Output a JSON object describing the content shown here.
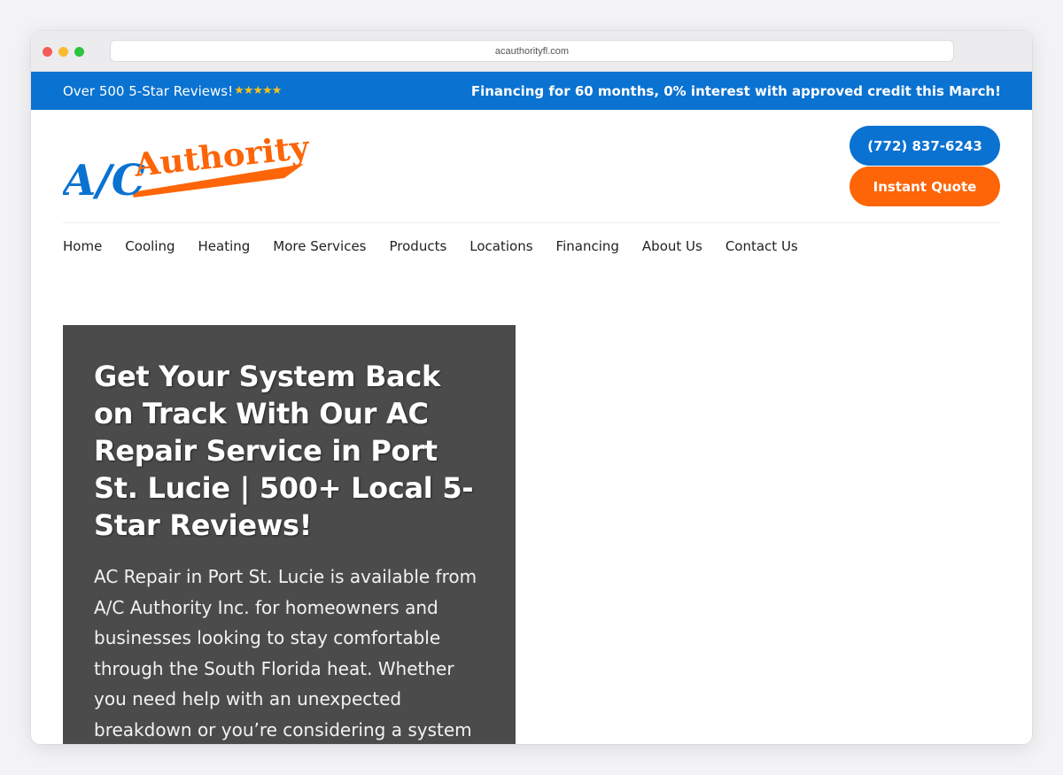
{
  "browser": {
    "url": "acauthorityfl.com"
  },
  "topbar": {
    "reviews_text": "Over 500 5-Star Reviews!",
    "stars": "★★★★★",
    "financing_text": "Financing for 60 months, 0% interest with approved credit this March!"
  },
  "logo": {
    "part1": "A/C",
    "part2": "Authority",
    "colors": {
      "blue": "#0a72d1",
      "orange": "#fd6508"
    }
  },
  "cta": {
    "phone_label": "(772) 837-6243",
    "quote_label": "Instant Quote"
  },
  "nav": {
    "items": [
      "Home",
      "Cooling",
      "Heating",
      "More Services",
      "Products",
      "Locations",
      "Financing",
      "About Us",
      "Contact Us"
    ]
  },
  "hero": {
    "title": "Get Your System Back on Track With Our AC Repair Service in Port St. Lucie | 500+ Local 5-Star Reviews!",
    "body": "AC Repair in Port St. Lucie is available from A/C Authority Inc. for homeowners and businesses looking to stay comfortable through the South Florida heat. Whether you need help with an unexpected breakdown or you’re considering a system"
  },
  "theme": {
    "brand_blue": "#0a72d1",
    "brand_orange": "#fd6508",
    "hero_bg": "#4b4b4b"
  }
}
